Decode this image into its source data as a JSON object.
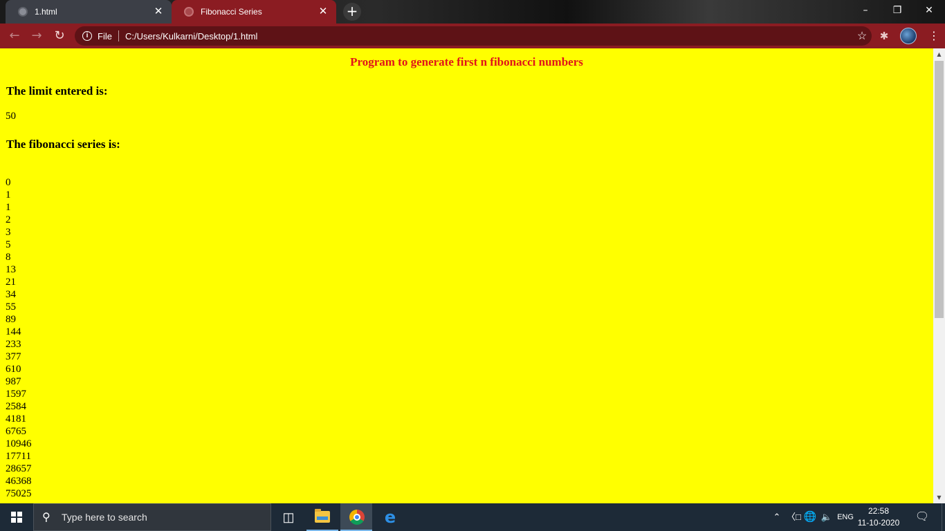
{
  "browser": {
    "tabs": [
      {
        "title": "1.html",
        "active": false
      },
      {
        "title": "Fibonacci Series",
        "active": true
      }
    ],
    "new_tab_label": "+",
    "url_scheme_label": "File",
    "url": "C:/Users/Kulkarni/Desktop/1.html",
    "accent_color": "#8b1c22"
  },
  "page": {
    "background_color": "#ffff00",
    "heading": "Program to generate first n fibonacci numbers",
    "heading_color": "#e0141a",
    "limit_heading": "The limit entered is:",
    "limit_value": "50",
    "series_heading": "The fibonacci series is:",
    "series": [
      "0",
      "1",
      "1",
      "2",
      "3",
      "5",
      "8",
      "13",
      "21",
      "34",
      "55",
      "89",
      "144",
      "233",
      "377",
      "610",
      "987",
      "1597",
      "2584",
      "4181",
      "6765",
      "10946",
      "17711",
      "28657",
      "46368",
      "75025"
    ]
  },
  "taskbar": {
    "search_placeholder": "Type here to search",
    "pinned": [
      "task-view-icon",
      "file-explorer-icon",
      "chrome-icon",
      "edge-icon"
    ],
    "language": "ENG",
    "time": "22:58",
    "date": "11-10-2020"
  }
}
